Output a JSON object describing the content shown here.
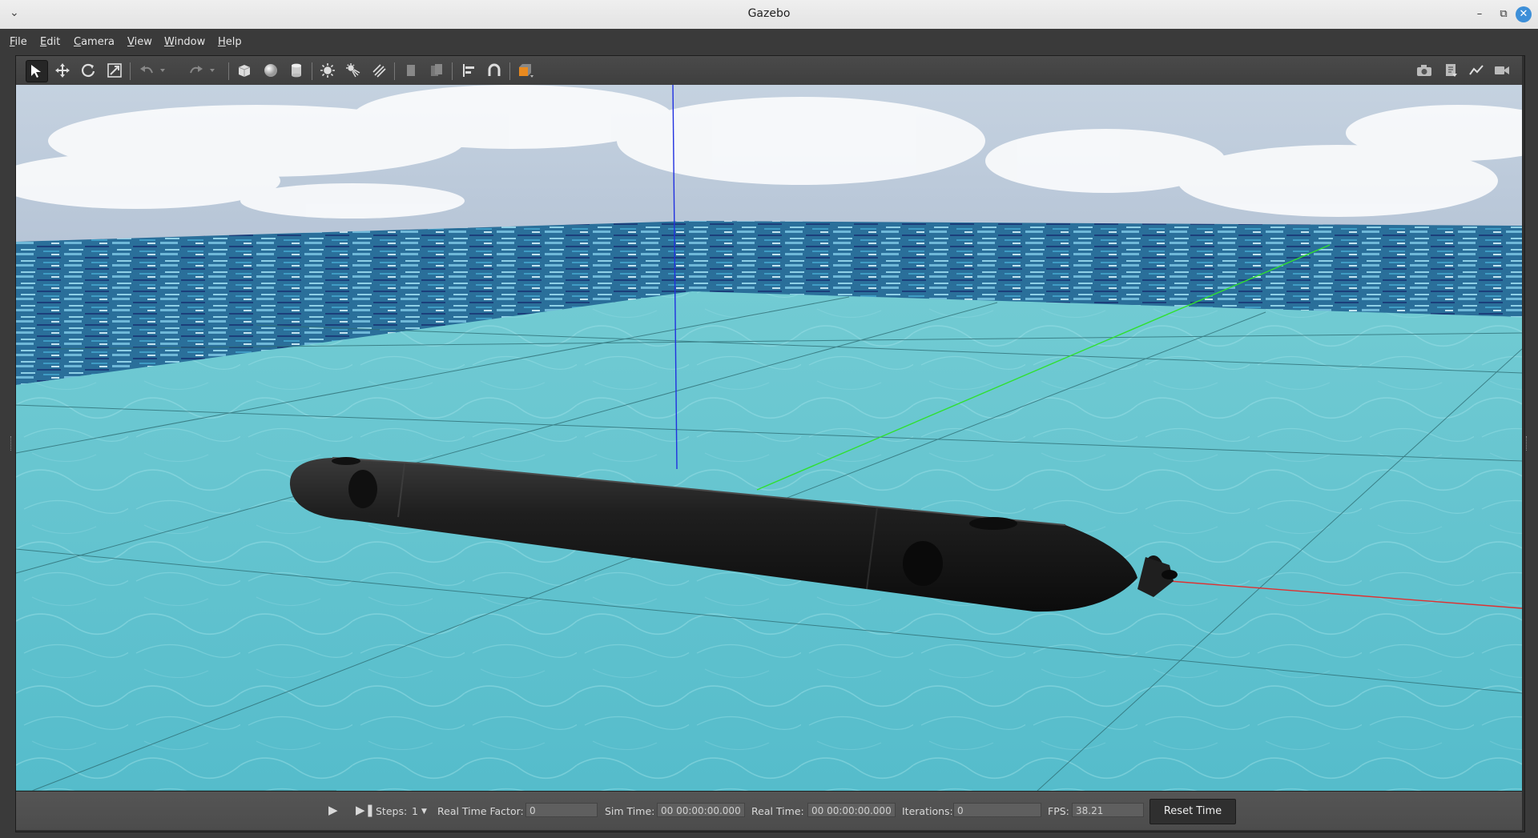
{
  "window": {
    "title": "Gazebo"
  },
  "menu": {
    "items": [
      {
        "u": "F",
        "rest": "ile"
      },
      {
        "u": "E",
        "rest": "dit"
      },
      {
        "u": "C",
        "rest": "amera"
      },
      {
        "u": "V",
        "rest": "iew"
      },
      {
        "u": "W",
        "rest": "indow"
      },
      {
        "u": "H",
        "rest": "elp"
      }
    ]
  },
  "toolbar": {
    "left_tools": [
      "select-icon",
      "translate-icon",
      "rotate-icon",
      "scale-icon",
      "undo-icon",
      "undo-history-icon",
      "redo-icon",
      "redo-history-icon",
      "box-icon",
      "sphere-icon",
      "cylinder-icon",
      "point-light-icon",
      "spot-light-icon",
      "directional-light-icon",
      "copy-icon",
      "paste-icon",
      "align-icon",
      "snap-icon",
      "view-angle-icon"
    ],
    "right_tools": [
      "screenshot-icon",
      "log-icon",
      "plot-icon",
      "video-record-icon"
    ]
  },
  "bottom": {
    "steps_label": "Steps:",
    "steps_value": "1",
    "rtf_label": "Real Time Factor:",
    "rtf_value": "0",
    "sim_label": "Sim Time:",
    "sim_value": "00 00:00:00.000",
    "real_label": "Real Time:",
    "real_value": "00 00:00:00.000",
    "iter_label": "Iterations:",
    "iter_value": "0",
    "fps_label": "FPS:",
    "fps_value": "38.21",
    "reset_label": "Reset Time"
  },
  "colors": {
    "accent": "#3d8fd8",
    "floor": "#5ec3cd",
    "sky": "#b8c6d8",
    "x_axis": "#e03030",
    "y_axis": "#30e030",
    "z_axis": "#2030e0"
  }
}
